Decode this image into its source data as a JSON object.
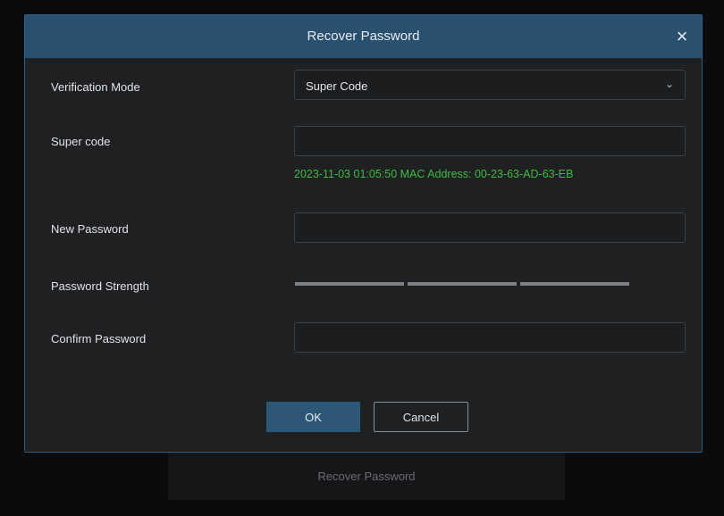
{
  "background": {
    "recover_password_label": "Recover Password"
  },
  "dialog": {
    "title": "Recover Password",
    "close_glyph": "×",
    "verification_mode": {
      "label": "Verification Mode",
      "selected": "Super Code",
      "chevron_glyph": "⌄"
    },
    "super_code": {
      "label": "Super code",
      "value": "",
      "placeholder": ""
    },
    "hint_text": "2023-11-03 01:05:50 MAC Address: 00-23-63-AD-63-EB",
    "new_password": {
      "label": "New Password",
      "value": ""
    },
    "password_strength": {
      "label": "Password Strength",
      "segments": 3
    },
    "confirm_password": {
      "label": "Confirm Password",
      "value": ""
    },
    "ok_label": "OK",
    "cancel_label": "Cancel"
  },
  "icons": {
    "close": "close-icon",
    "dropdown": "chevron-down-icon"
  },
  "colors": {
    "header": "#2a5070",
    "ok_button": "#2c5777",
    "hint_green": "#3dbb3d",
    "dialog_bg": "#1e2022"
  }
}
